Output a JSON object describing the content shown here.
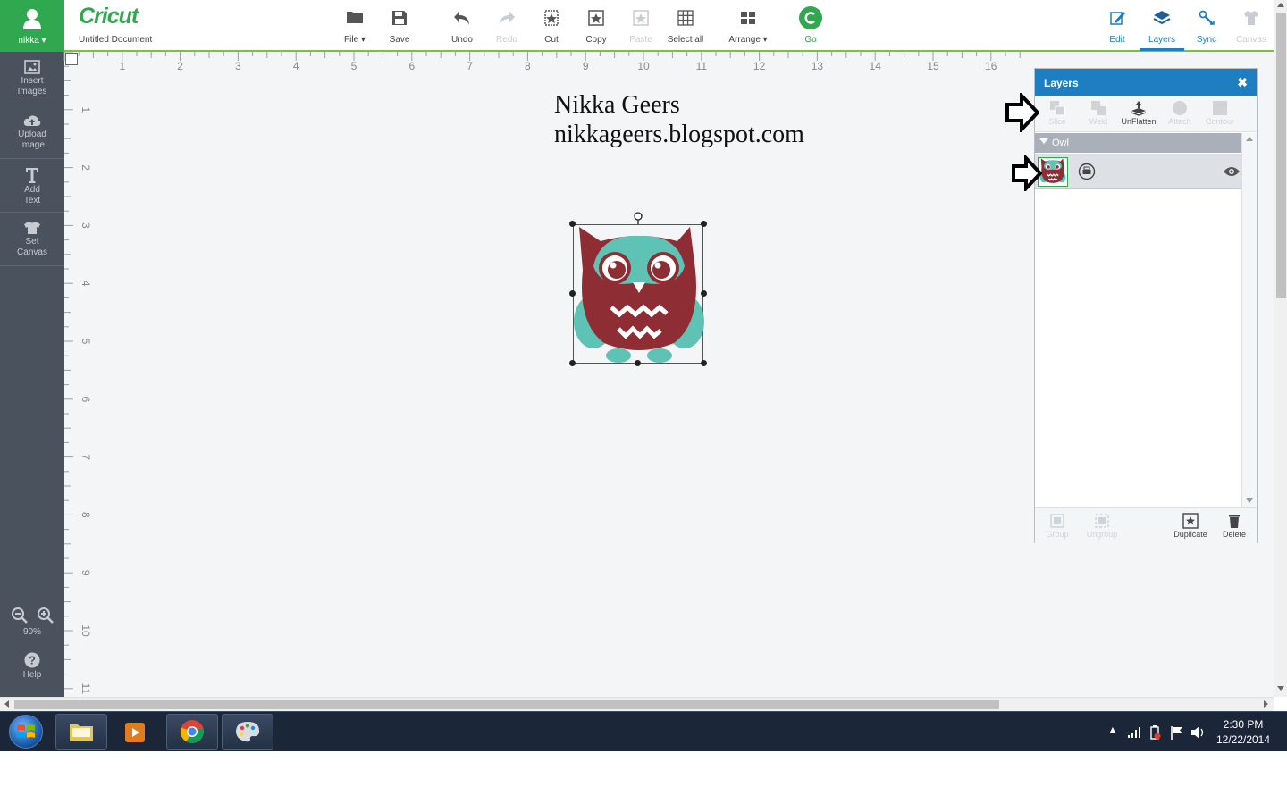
{
  "user": {
    "name": "nikka ▾"
  },
  "app": {
    "logo": "Cricut",
    "document_title": "Untitled Document"
  },
  "toolbar": [
    {
      "id": "file",
      "label": "File ▾",
      "icon": "folder-icon",
      "enabled": true
    },
    {
      "id": "save",
      "label": "Save",
      "icon": "save-icon",
      "enabled": true
    },
    {
      "id": "undo",
      "label": "Undo",
      "icon": "undo-icon",
      "enabled": true
    },
    {
      "id": "redo",
      "label": "Redo",
      "icon": "redo-icon",
      "enabled": false
    },
    {
      "id": "cut",
      "label": "Cut",
      "icon": "cut-icon",
      "enabled": true
    },
    {
      "id": "copy",
      "label": "Copy",
      "icon": "copy-icon",
      "enabled": true
    },
    {
      "id": "paste",
      "label": "Paste",
      "icon": "paste-icon",
      "enabled": false
    },
    {
      "id": "select_all",
      "label": "Select all",
      "icon": "grid-icon",
      "enabled": true
    },
    {
      "id": "arrange",
      "label": "Arrange ▾",
      "icon": "arrange-icon",
      "enabled": true
    },
    {
      "id": "go",
      "label": "Go",
      "icon": "go-icon",
      "enabled": true
    }
  ],
  "right_toolbar": [
    {
      "id": "edit",
      "label": "Edit",
      "icon": "edit-icon",
      "enabled": true
    },
    {
      "id": "layers",
      "label": "Layers",
      "icon": "layers-icon",
      "enabled": true,
      "active": true
    },
    {
      "id": "sync",
      "label": "Sync",
      "icon": "sync-icon",
      "enabled": true
    },
    {
      "id": "canvas",
      "label": "Canvas",
      "icon": "shirt-icon",
      "enabled": false
    }
  ],
  "sidebar": {
    "items": [
      {
        "id": "insert_images",
        "line1": "Insert",
        "line2": "Images",
        "icon": "image-icon"
      },
      {
        "id": "upload_image",
        "line1": "Upload",
        "line2": "Image",
        "icon": "upload-icon"
      },
      {
        "id": "add_text",
        "line1": "Add",
        "line2": "Text",
        "icon": "text-icon"
      },
      {
        "id": "set_canvas",
        "line1": "Set",
        "line2": "Canvas",
        "icon": "shirt-icon"
      }
    ],
    "zoom_level": "90%",
    "help_label": "Help"
  },
  "ruler": {
    "top": [
      "1",
      "2",
      "3",
      "4",
      "5",
      "6",
      "7",
      "8",
      "9",
      "10",
      "11",
      "12",
      "13",
      "14",
      "15",
      "16"
    ],
    "left": [
      "1",
      "2",
      "3",
      "4",
      "5",
      "6",
      "7",
      "8",
      "9",
      "10",
      "11"
    ]
  },
  "canvas": {
    "watermark_line1": "Nikka Geers",
    "watermark_line2": "nikkageers.blogspot.com"
  },
  "layers_panel": {
    "title": "Layers",
    "close": "✖",
    "tools": [
      {
        "id": "slice",
        "label": "Slice",
        "enabled": false
      },
      {
        "id": "weld",
        "label": "Weld",
        "enabled": false
      },
      {
        "id": "unflatten",
        "label": "UnFlatten",
        "enabled": true
      },
      {
        "id": "attach",
        "label": "Attach",
        "enabled": false
      },
      {
        "id": "contour",
        "label": "Contour",
        "enabled": false
      }
    ],
    "group_name": "Owl",
    "footer": [
      {
        "id": "group",
        "label": "Group",
        "enabled": false
      },
      {
        "id": "ungroup",
        "label": "Ungroup",
        "enabled": false
      },
      {
        "id": "duplicate",
        "label": "Duplicate",
        "enabled": true
      },
      {
        "id": "delete",
        "label": "Delete",
        "enabled": true
      }
    ]
  },
  "taskbar": {
    "time": "2:30 PM",
    "date": "12/22/2014"
  },
  "colors": {
    "brand_green": "#2fa84f",
    "accent_blue": "#1d7fc1",
    "sidebar_bg": "#4a525e",
    "owl_maroon": "#8e2d33",
    "owl_teal": "#5ec3b4"
  }
}
